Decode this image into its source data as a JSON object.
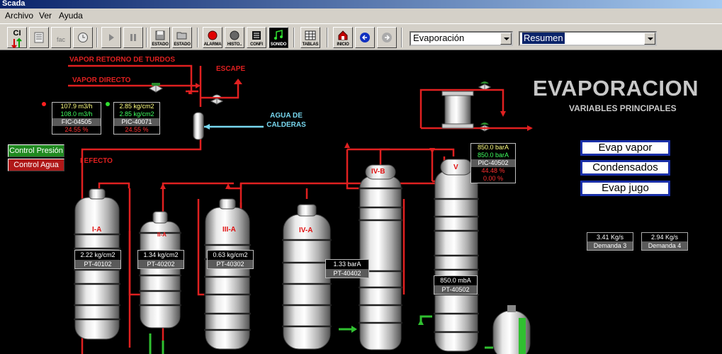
{
  "window": {
    "title": "Scada"
  },
  "menu": [
    "Archivo",
    "Ver",
    "Ayuda"
  ],
  "toolbar": {
    "buttons": [
      {
        "name": "ci",
        "label": "",
        "text": "CI"
      },
      {
        "name": "report",
        "label": "",
        "text": ""
      },
      {
        "name": "fac",
        "label": "",
        "text": "fac"
      },
      {
        "name": "clock",
        "label": "",
        "text": ""
      },
      {
        "name": "play",
        "label": "",
        "text": ""
      },
      {
        "name": "pause",
        "label": "",
        "text": ""
      },
      {
        "name": "estado-save",
        "label": "ESTADO",
        "text": ""
      },
      {
        "name": "estado-open",
        "label": "ESTADO",
        "text": ""
      },
      {
        "name": "alarma",
        "label": "ALARMA",
        "text": ""
      },
      {
        "name": "historico",
        "label": "HISTO..",
        "text": ""
      },
      {
        "name": "config",
        "label": "CONFI",
        "text": ""
      },
      {
        "name": "sonido",
        "label": "SONIDO",
        "text": ""
      },
      {
        "name": "tablas",
        "label": "TABLAS",
        "text": ""
      },
      {
        "name": "inicio",
        "label": "INICIO",
        "text": ""
      },
      {
        "name": "back",
        "label": "",
        "text": ""
      },
      {
        "name": "forward",
        "label": "",
        "text": ""
      }
    ],
    "combo_area": "Evaporación",
    "combo_view": "Resumen"
  },
  "canvas": {
    "labels": {
      "vapor_retorno": "VAPOR RETORNO DE TURDOS",
      "vapor_directo": "VAPOR DIRECTO",
      "escape": "ESCAPE",
      "agua_calderas_1": "AGUA DE",
      "agua_calderas_2": "CALDERAS",
      "efecto": "I EFECTO",
      "title": "EVAPORACION",
      "subtitle": "VARIABLES PRINCIPALES"
    },
    "control_buttons": {
      "presion": "Control Presión",
      "agua": "Control Agua"
    },
    "nav_buttons": [
      "Evap vapor",
      "Condensados",
      "Evap jugo"
    ],
    "fic": {
      "v1": "107.9 m3/h",
      "v2": "108.0 m3/h",
      "tag": "FIC-04505",
      "out": "24.55 %"
    },
    "pic71": {
      "v1": "2.85 kg/cm2",
      "v2": "2.85 kg/cm2",
      "tag": "PIC-40071",
      "out": "24.55 %"
    },
    "pic502": {
      "v1": "850.0 barA",
      "v2": "850.0 barA",
      "tag": "PIC-40502",
      "out1": "44.48 %",
      "out2": "0.00 %"
    },
    "vessels": [
      "I-A",
      "II-A",
      "III-A",
      "IV-A",
      "IV-B",
      "V"
    ],
    "pt": [
      {
        "val": "2.22 kg/cm2",
        "tag": "PT-40102"
      },
      {
        "val": "1.34 kg/cm2",
        "tag": "PT-40202"
      },
      {
        "val": "0.63 kg/cm2",
        "tag": "PT-40302"
      },
      {
        "val": "1.33 barA",
        "tag": "PT-40402"
      },
      {
        "val": "850.0 mbA",
        "tag": "PT-40502"
      }
    ],
    "demand": [
      {
        "val": "3.41 Kg/s",
        "label": "Demanda 3"
      },
      {
        "val": "2.94 Kg/s",
        "label": "Demanda 4"
      }
    ]
  }
}
